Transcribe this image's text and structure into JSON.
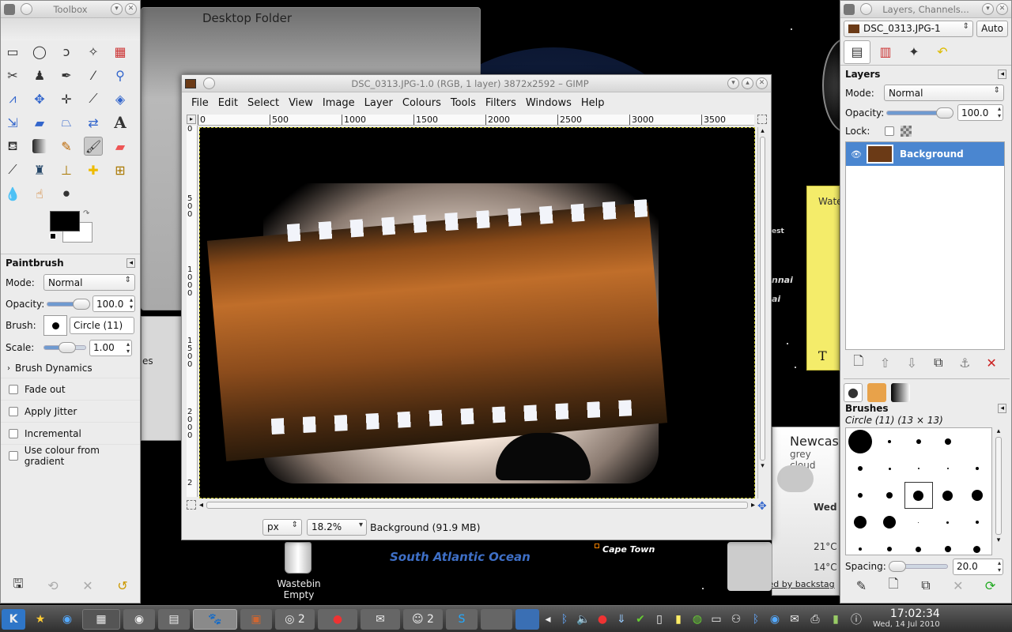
{
  "desktop": {
    "folder_title": "Desktop Folder",
    "wastebin_label": "Wastebin",
    "wastebin_state": "Empty",
    "map_label_ocean": "South Atlantic Ocean",
    "map_label_city": "Cape Town",
    "map_partial_1": "est",
    "map_partial_2": "nnai",
    "map_partial_3": "ai",
    "note_partial": "Wate",
    "note_icon": "T",
    "weather_city": "Newcas",
    "weather_desc": "grey cloud",
    "weather_day": "Wed",
    "weather_hi": "21°C",
    "weather_lo": "14°C",
    "weather_footer": "Supported by backstag",
    "partial_tab": "es"
  },
  "toolbox": {
    "title": "Toolbox",
    "tool_options_title": "Paintbrush",
    "mode_label": "Mode:",
    "mode_value": "Normal",
    "opacity_label": "Opacity:",
    "opacity_value": "100.0",
    "opacity_fraction": 1.0,
    "brush_label": "Brush:",
    "brush_value": "Circle (11)",
    "scale_label": "Scale:",
    "scale_value": "1.00",
    "dynamics_label": "Brush Dynamics",
    "options": [
      "Fade out",
      "Apply Jitter",
      "Incremental",
      "Use colour from gradient"
    ],
    "fg_color": "#000000",
    "bg_color": "#ffffff"
  },
  "image_window": {
    "title": "DSC_0313.JPG-1.0 (RGB, 1 layer) 3872x2592 – GIMP",
    "menu": [
      "File",
      "Edit",
      "Select",
      "View",
      "Image",
      "Layer",
      "Colours",
      "Tools",
      "Filters",
      "Windows",
      "Help"
    ],
    "ruler_ticks": [
      "0",
      "500",
      "1000",
      "1500",
      "2000",
      "2500",
      "3000",
      "3500"
    ],
    "vruler_ticks": [
      "0",
      "5 0 0",
      "1 0 0 0",
      "1 5 0 0",
      "2 0 0 0",
      "2"
    ],
    "unit": "px",
    "zoom": "18.2%",
    "status": "Background (91.9 MB)"
  },
  "layers": {
    "title": "Layers, Channels...",
    "image_select": "DSC_0313.JPG-1",
    "auto_label": "Auto",
    "panel_title": "Layers",
    "mode_label": "Mode:",
    "mode_value": "Normal",
    "opacity_label": "Opacity:",
    "opacity_value": "100.0",
    "opacity_fraction": 1.0,
    "lock_label": "Lock:",
    "layer_name": "Background"
  },
  "brushes": {
    "title": "Brushes",
    "selected": "Circle (11) (13 × 13)",
    "spacing_label": "Spacing:",
    "spacing_value": "20.0",
    "spacing_fraction": 0.1
  },
  "clock": {
    "time": "17:02:34",
    "date": "Wed, 14 Jul 2010"
  },
  "colors": {
    "accent": "#3d7cc9",
    "selection": "#4a86d0",
    "note": "#f4ec6a",
    "taskbar": "#3b3b3b"
  }
}
